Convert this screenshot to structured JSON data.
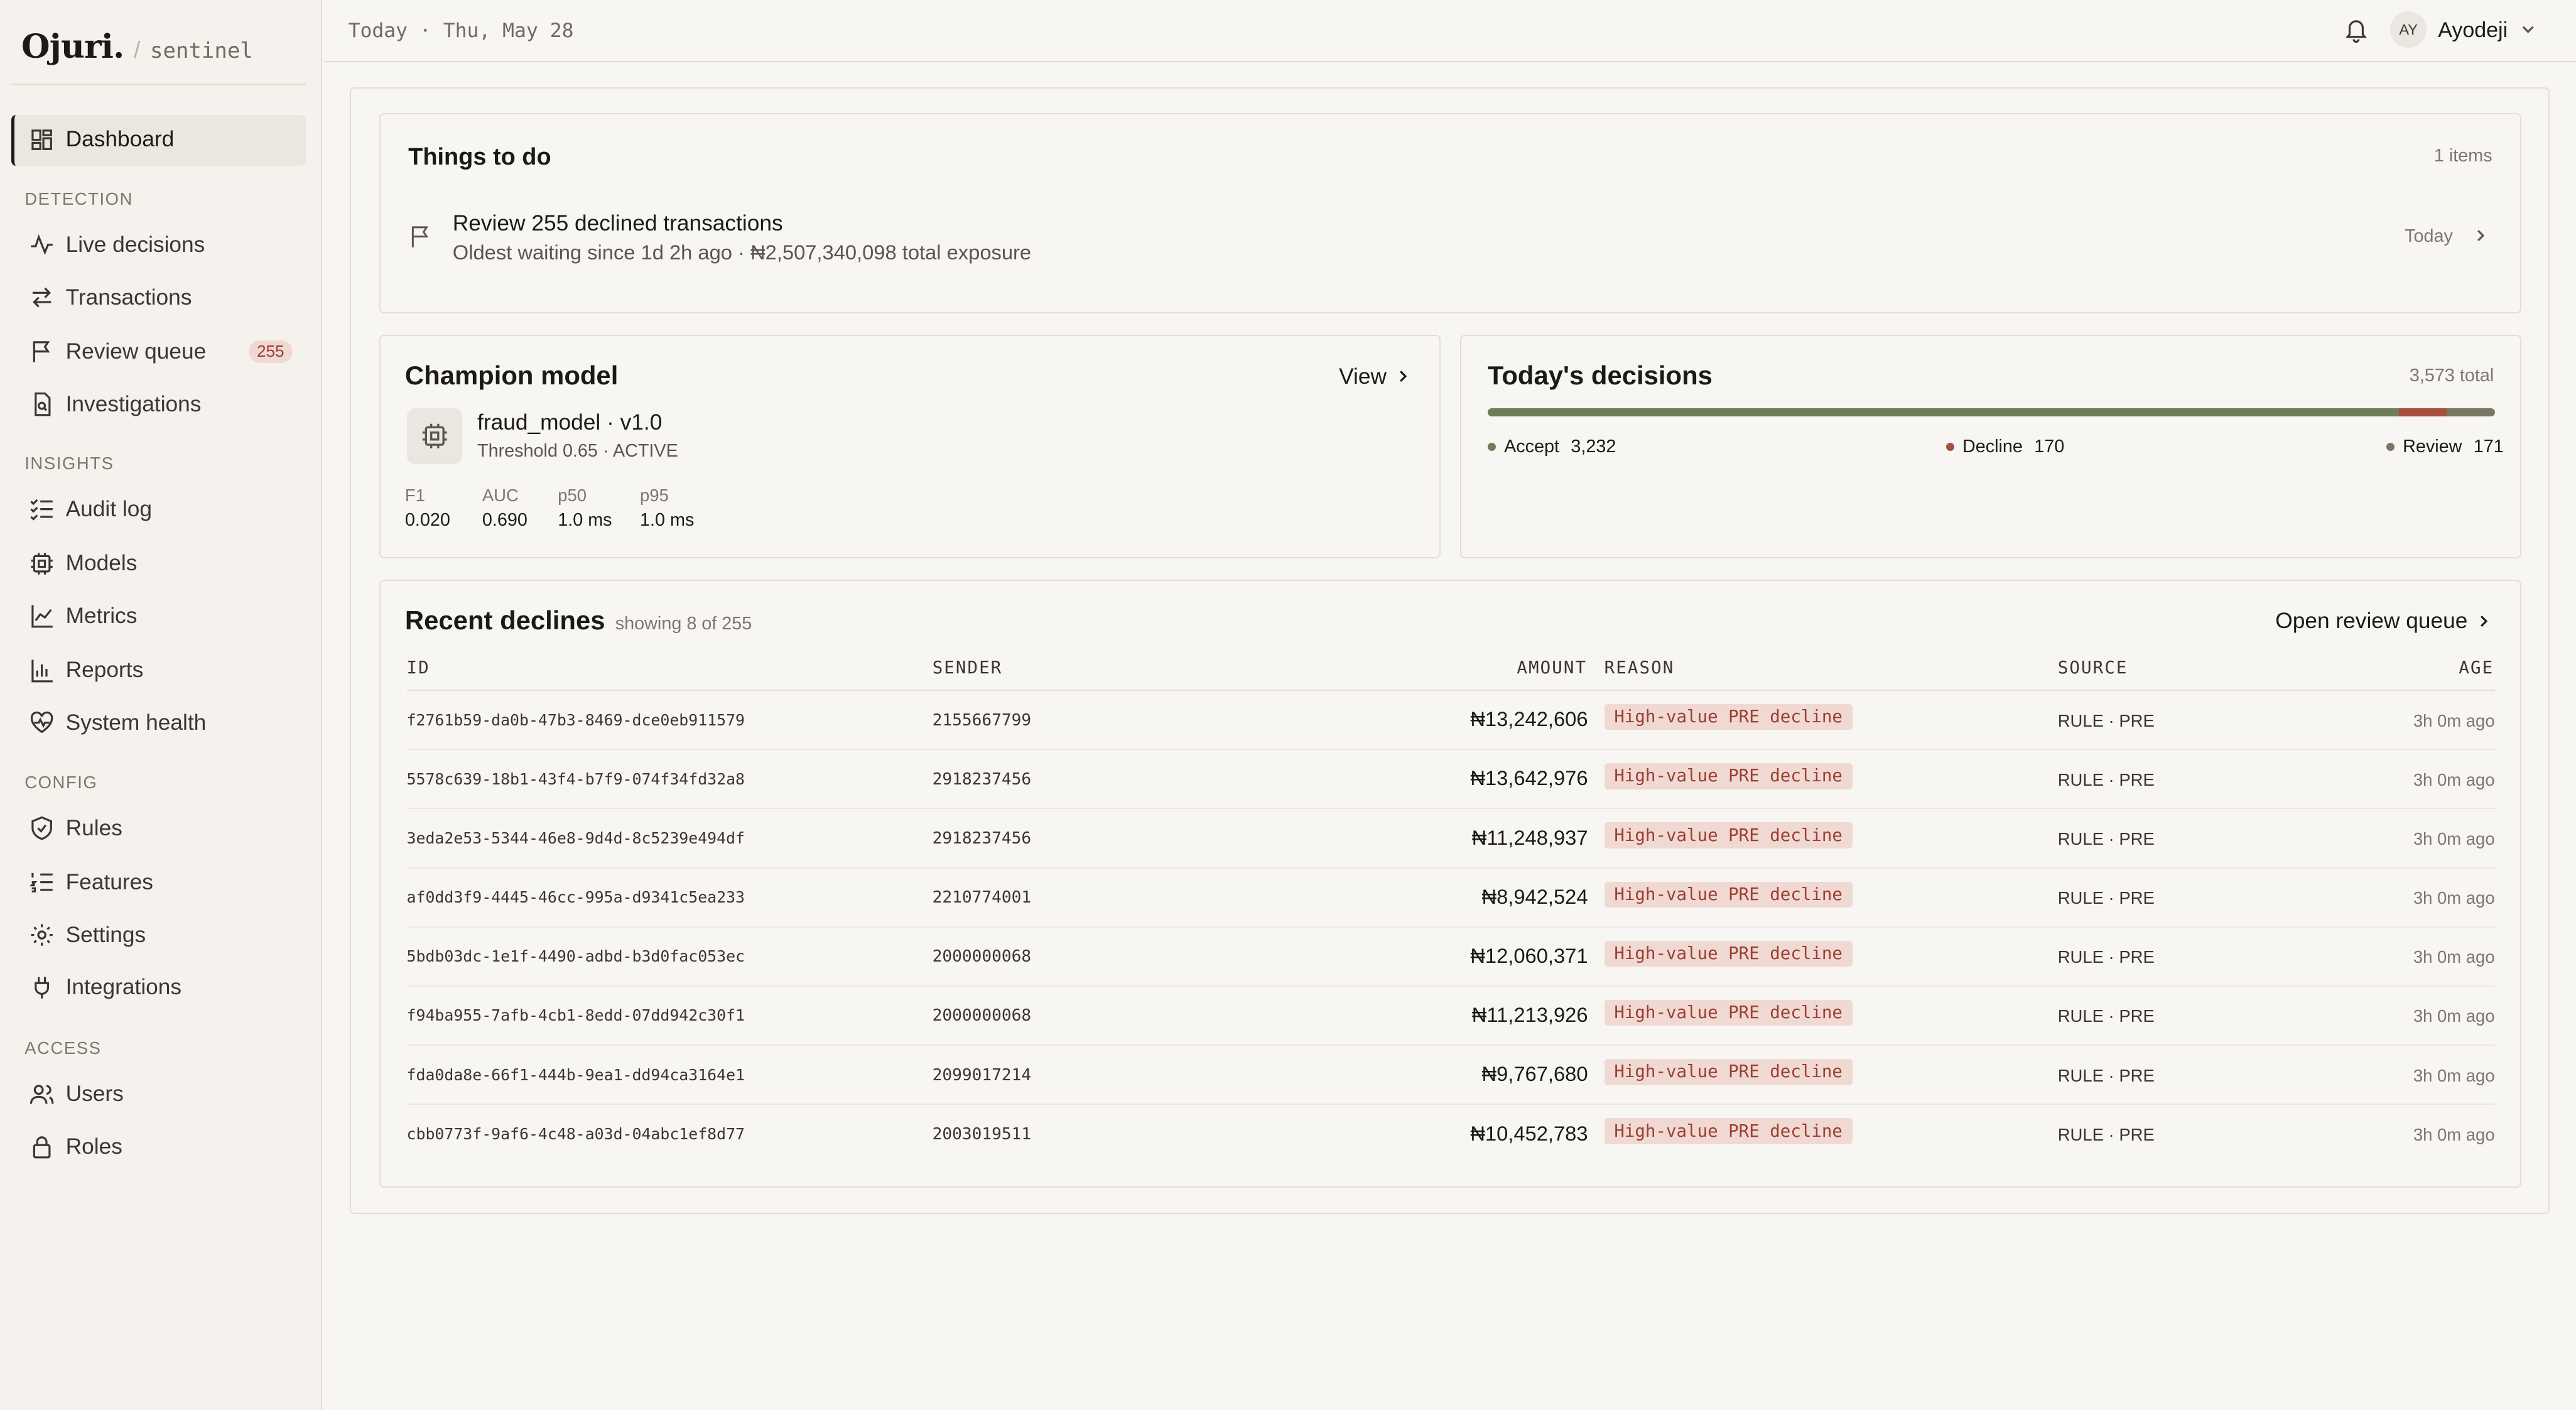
{
  "brand": {
    "name": "Ojuri.",
    "slash": "/",
    "product": "sentinel"
  },
  "header": {
    "date": "Today · Thu, May 28",
    "user_initials": "AY",
    "user_name": "Ayodeji"
  },
  "sidebar": {
    "dashboard": "Dashboard",
    "sections": {
      "detection": "DETECTION",
      "insights": "INSIGHTS",
      "config": "CONFIG",
      "access": "ACCESS"
    },
    "items": {
      "live_decisions": "Live decisions",
      "transactions": "Transactions",
      "review_queue": "Review queue",
      "review_queue_badge": "255",
      "investigations": "Investigations",
      "audit_log": "Audit log",
      "models": "Models",
      "metrics": "Metrics",
      "reports": "Reports",
      "system_health": "System health",
      "rules": "Rules",
      "features": "Features",
      "settings": "Settings",
      "integrations": "Integrations",
      "users": "Users",
      "roles": "Roles"
    }
  },
  "todo": {
    "title": "Things to do",
    "count": "1 items",
    "item_title": "Review 255 declined transactions",
    "item_sub": "Oldest waiting since 1d 2h ago · ₦2,507,340,098 total exposure",
    "item_date": "Today"
  },
  "champion": {
    "title": "Champion model",
    "view": "View",
    "model_name": "fraud_model · v1.0",
    "model_meta": "Threshold 0.65 · ACTIVE",
    "metrics": [
      {
        "label": "F1",
        "value": "0.020"
      },
      {
        "label": "AUC",
        "value": "0.690"
      },
      {
        "label": "p50",
        "value": "1.0 ms"
      },
      {
        "label": "p95",
        "value": "1.0 ms"
      }
    ]
  },
  "decisions": {
    "title": "Today's decisions",
    "total": "3,573 total",
    "accept_label": "Accept",
    "accept_value": "3,232",
    "decline_label": "Decline",
    "decline_value": "170",
    "review_label": "Review",
    "review_value": "171",
    "colors": {
      "accept": "#6e7c5a",
      "decline": "#a64f3f",
      "review": "#7a7865"
    }
  },
  "declines": {
    "title": "Recent declines",
    "subtitle": "showing 8 of 255",
    "open_link": "Open review queue",
    "columns": {
      "id": "ID",
      "sender": "SENDER",
      "amount": "AMOUNT",
      "reason": "REASON",
      "source": "SOURCE",
      "age": "AGE"
    },
    "rows": [
      {
        "id": "f2761b59-da0b-47b3-8469-dce0eb911579",
        "sender": "2155667799",
        "amount": "₦13,242,606",
        "reason": "High-value PRE decline",
        "source": "RULE · PRE",
        "age": "3h 0m ago"
      },
      {
        "id": "5578c639-18b1-43f4-b7f9-074f34fd32a8",
        "sender": "2918237456",
        "amount": "₦13,642,976",
        "reason": "High-value PRE decline",
        "source": "RULE · PRE",
        "age": "3h 0m ago"
      },
      {
        "id": "3eda2e53-5344-46e8-9d4d-8c5239e494df",
        "sender": "2918237456",
        "amount": "₦11,248,937",
        "reason": "High-value PRE decline",
        "source": "RULE · PRE",
        "age": "3h 0m ago"
      },
      {
        "id": "af0dd3f9-4445-46cc-995a-d9341c5ea233",
        "sender": "2210774001",
        "amount": "₦8,942,524",
        "reason": "High-value PRE decline",
        "source": "RULE · PRE",
        "age": "3h 0m ago"
      },
      {
        "id": "5bdb03dc-1e1f-4490-adbd-b3d0fac053ec",
        "sender": "2000000068",
        "amount": "₦12,060,371",
        "reason": "High-value PRE decline",
        "source": "RULE · PRE",
        "age": "3h 0m ago"
      },
      {
        "id": "f94ba955-7afb-4cb1-8edd-07dd942c30f1",
        "sender": "2000000068",
        "amount": "₦11,213,926",
        "reason": "High-value PRE decline",
        "source": "RULE · PRE",
        "age": "3h 0m ago"
      },
      {
        "id": "fda0da8e-66f1-444b-9ea1-dd94ca3164e1",
        "sender": "2099017214",
        "amount": "₦9,767,680",
        "reason": "High-value PRE decline",
        "source": "RULE · PRE",
        "age": "3h 0m ago"
      },
      {
        "id": "cbb0773f-9af6-4c48-a03d-04abc1ef8d77",
        "sender": "2003019511",
        "amount": "₦10,452,783",
        "reason": "High-value PRE decline",
        "source": "RULE · PRE",
        "age": "3h 0m ago"
      }
    ]
  }
}
